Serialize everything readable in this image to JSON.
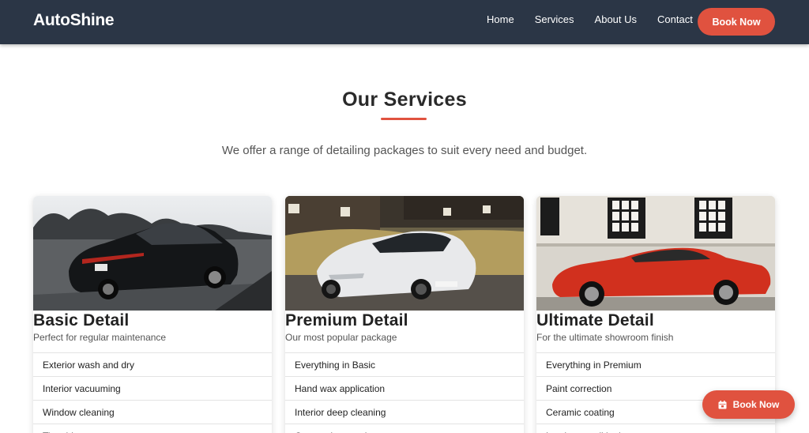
{
  "nav": {
    "brand": "AutoShine",
    "links": [
      "Home",
      "Services",
      "About Us",
      "Contact"
    ],
    "cta": "Book Now"
  },
  "section": {
    "title": "Our Services",
    "subtitle": "We offer a range of detailing packages to suit every need and budget."
  },
  "cards": [
    {
      "name": "Basic Detail",
      "tagline": "Perfect for regular maintenance",
      "image": "black-sedan-photo",
      "features": [
        "Exterior wash and dry",
        "Interior vacuuming",
        "Window cleaning",
        "Tire shine"
      ]
    },
    {
      "name": "Premium Detail",
      "tagline": "Our most popular package",
      "image": "white-supercar-photo",
      "features": [
        "Everything in Basic",
        "Hand wax application",
        "Interior deep cleaning",
        "Carpet shampooing"
      ]
    },
    {
      "name": "Ultimate Detail",
      "tagline": "For the ultimate showroom finish",
      "image": "red-sports-car-photo",
      "features": [
        "Everything in Premium",
        "Paint correction",
        "Ceramic coating",
        "Leather conditioning"
      ]
    }
  ],
  "floating_cta": {
    "label": "Book Now",
    "icon": "calendar-icon"
  },
  "colors": {
    "nav_bg": "#2b3646",
    "accent": "#e0523f"
  }
}
